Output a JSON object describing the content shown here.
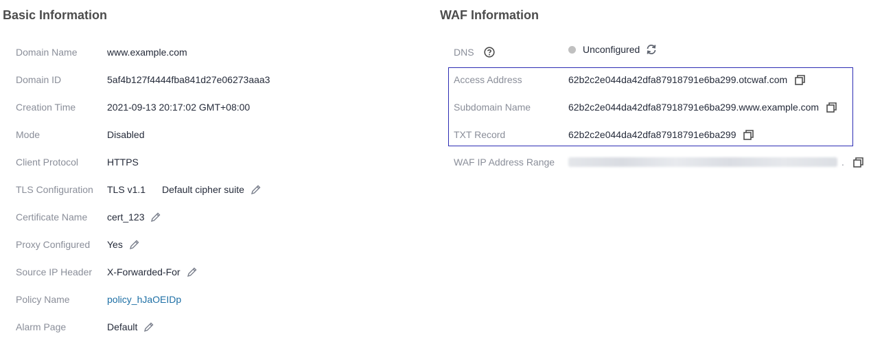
{
  "basic_info": {
    "title": "Basic Information",
    "rows": [
      {
        "label": "Domain Name",
        "value": "www.example.com"
      },
      {
        "label": "Domain ID",
        "value": "5af4b127f4444fba841d27e06273aaa3"
      },
      {
        "label": "Creation Time",
        "value": "2021-09-13 20:17:02 GMT+08:00"
      },
      {
        "label": "Mode",
        "value": "Disabled"
      },
      {
        "label": "Client Protocol",
        "value": "HTTPS"
      },
      {
        "label": "TLS Configuration",
        "value": "TLS v1.1",
        "extra": "Default cipher suite"
      },
      {
        "label": "Certificate Name",
        "value": "cert_123"
      },
      {
        "label": "Proxy Configured",
        "value": "Yes"
      },
      {
        "label": "Source IP Header",
        "value": "X-Forwarded-For"
      },
      {
        "label": "Policy Name",
        "value": "policy_hJaOEIDp"
      },
      {
        "label": "Alarm Page",
        "value": "Default"
      }
    ]
  },
  "waf_info": {
    "title": "WAF Information",
    "dns": {
      "label": "DNS",
      "status": "Unconfigured",
      "status_color": "#c0c0c0"
    },
    "rows": [
      {
        "label": "Access Address",
        "value": "62b2c2e044da42dfa87918791e6ba299.otcwaf.com"
      },
      {
        "label": "Subdomain Name",
        "value": "62b2c2e044da42dfa87918791e6ba299.www.example.com"
      },
      {
        "label": "TXT Record",
        "value": "62b2c2e044da42dfa87918791e6ba299"
      },
      {
        "label": "WAF IP Address Range",
        "value": "."
      }
    ]
  },
  "colors": {
    "link": "#1d6fa5",
    "highlight_border": "#2b2bb3",
    "label": "#8a8e99"
  },
  "icons": [
    "edit-icon",
    "copy-icon",
    "help-icon",
    "refresh-icon"
  ]
}
